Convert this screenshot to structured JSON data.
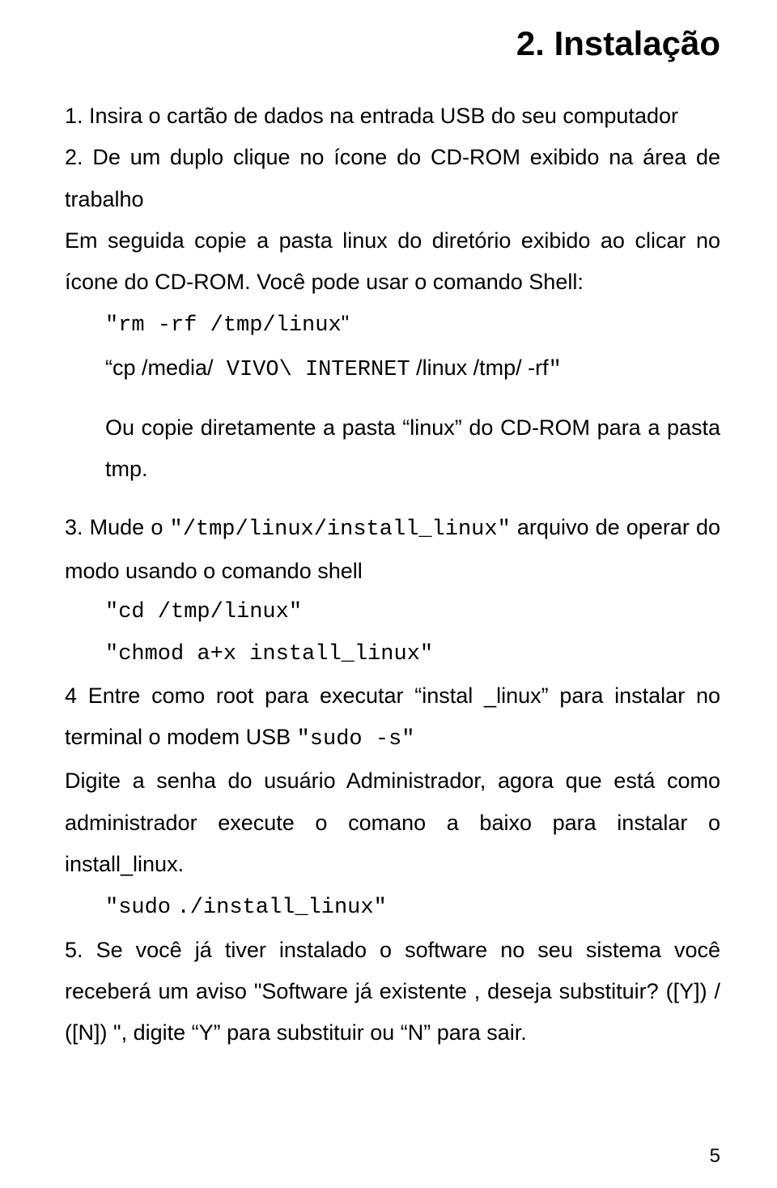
{
  "title": "2. Instalação",
  "step1": "1. Insira o cartão de dados na entrada USB do seu computador",
  "step2_a": "2. De um duplo clique no ícone do CD-ROM exibido na área de trabalho",
  "step2_b": "Em seguida copie a pasta linux do diretório exibido ao clicar no ícone do CD-ROM. Você pode usar o comando Shell:",
  "cmd1_a": "\"rm -rf /tmp/linux",
  "cmd1_b": "\"",
  "cmd2_a": "“cp   /media/",
  "cmd2_b": " VIVO\\ INTERNET",
  "cmd2_c": " /linux /tmp/ -rf",
  "cmd2_d": "\"",
  "step2_c": "Ou copie diretamente a pasta “linux” do CD-ROM para a pasta tmp.",
  "step3_a": "3.  Mude  o  ",
  "step3_b": "\"/tmp/linux/install_linux\"",
  "step3_c": "  arquivo  de  operar  do modo usando o comando shell",
  "cmd3": "\"cd /tmp/linux\"",
  "cmd4": "\"chmod a+x install_linux\"",
  "step4_a": "4   Entre como root para executar  “instal _linux” para instalar no terminal o modem USB     ",
  "step4_b": "\"sudo -s\"",
  "step4_c": "Digite  a  senha  do  usuário  Administrador,  agora  que  está  como administrador execute o comano a baixo para instalar o install_linux.",
  "cmd5_a": "\"sudo",
  "cmd5_b": "./install_linux\"",
  "step5": "5. Se você já tiver instalado o software no seu sistema você receberá um aviso \"Software já existente , deseja substituir? ([Y]) / ([N]) \", digite “Y” para substituir ou “N” para sair.",
  "pagenum": "5"
}
